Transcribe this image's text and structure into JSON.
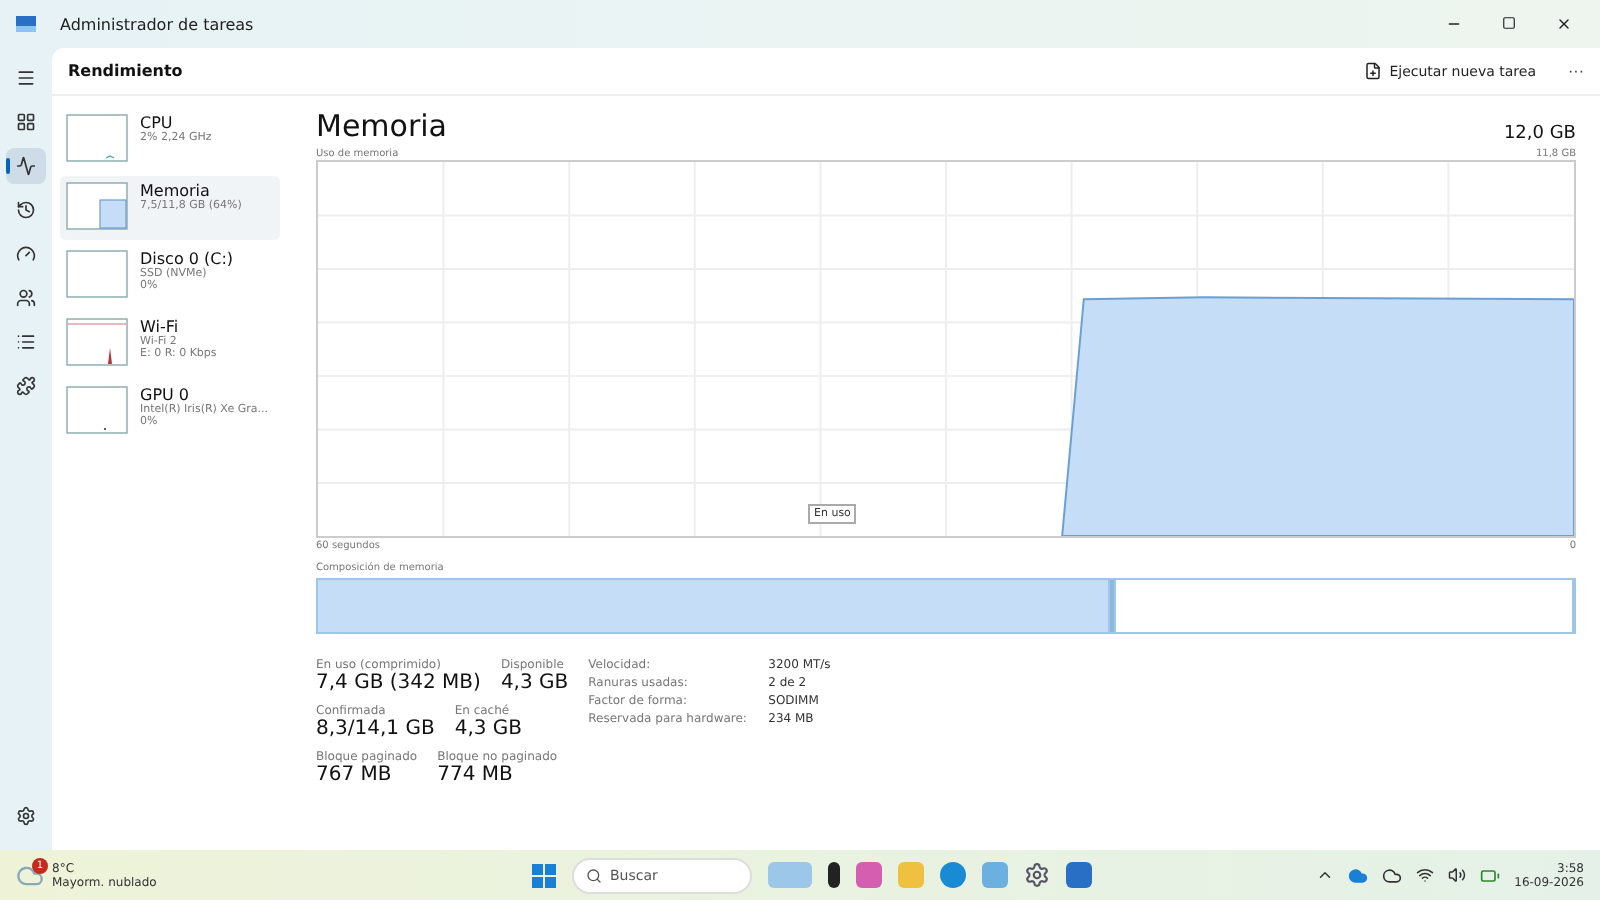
{
  "window": {
    "title": "Administrador de tareas"
  },
  "nav": [
    {
      "selected": false
    },
    {
      "selected": false
    },
    {
      "selected": true
    },
    {
      "selected": false
    },
    {
      "selected": false
    },
    {
      "selected": false
    },
    {
      "selected": false
    },
    {
      "selected": false
    }
  ],
  "header": {
    "title": "Rendimiento",
    "run_task": "Ejecutar nueva tarea",
    "more": "···"
  },
  "devices": [
    {
      "name": "CPU",
      "lines": [
        "2% 2,24 GHz"
      ],
      "selected": false,
      "kind": "cpu"
    },
    {
      "name": "Memoria",
      "lines": [
        "7,5/11,8 GB (64%)"
      ],
      "selected": true,
      "kind": "memory"
    },
    {
      "name": "Disco 0 (C:)",
      "lines": [
        "SSD (NVMe)",
        "0%"
      ],
      "selected": false,
      "kind": "disk"
    },
    {
      "name": "Wi-Fi",
      "lines": [
        "Wi-Fi 2",
        "E: 0 R: 0 Kbps"
      ],
      "selected": false,
      "kind": "wifi"
    },
    {
      "name": "GPU 0",
      "lines": [
        "Intel(R) Iris(R) Xe Gra...",
        "0%"
      ],
      "selected": false,
      "kind": "gpu"
    }
  ],
  "main": {
    "title": "Memoria",
    "total": "12,0 GB",
    "graph_label": "Uso de memoria",
    "graph_max": "11,8 GB",
    "graph_time": "60 segundos",
    "graph_min": "0",
    "tooltip": "En uso",
    "composition_label": "Composición de memoria",
    "composition": [
      {
        "kind": "in_use",
        "level": 0.63
      },
      {
        "kind": "modified",
        "level": 0.005
      },
      {
        "kind": "standby",
        "level": 0.365
      }
    ],
    "stats": [
      [
        {
          "label": "En uso (comprimido)",
          "value": "7,4 GB (342 MB)"
        },
        {
          "label": "Disponible",
          "value": "4,3 GB"
        }
      ],
      [
        {
          "label": "Confirmada",
          "value": "8,3/14,1 GB"
        },
        {
          "label": "En caché",
          "value": "4,3 GB"
        }
      ],
      [
        {
          "label": "Bloque paginado",
          "value": "767 MB"
        },
        {
          "label": "Bloque no paginado",
          "value": "774 MB"
        }
      ]
    ],
    "details": [
      {
        "label": "Velocidad:",
        "value": "3200 MT/s"
      },
      {
        "label": "Ranuras usadas:",
        "value": "2 de 2"
      },
      {
        "label": "Factor de forma:",
        "value": "SODIMM"
      },
      {
        "label": "Reservada para hardware:",
        "value": "234 MB"
      }
    ]
  },
  "taskbar": {
    "temp": "8°C",
    "weather": "Mayorm. nublado",
    "badge": "1",
    "search": "Buscar",
    "time": "3:58",
    "date": "16-09-2026"
  }
}
